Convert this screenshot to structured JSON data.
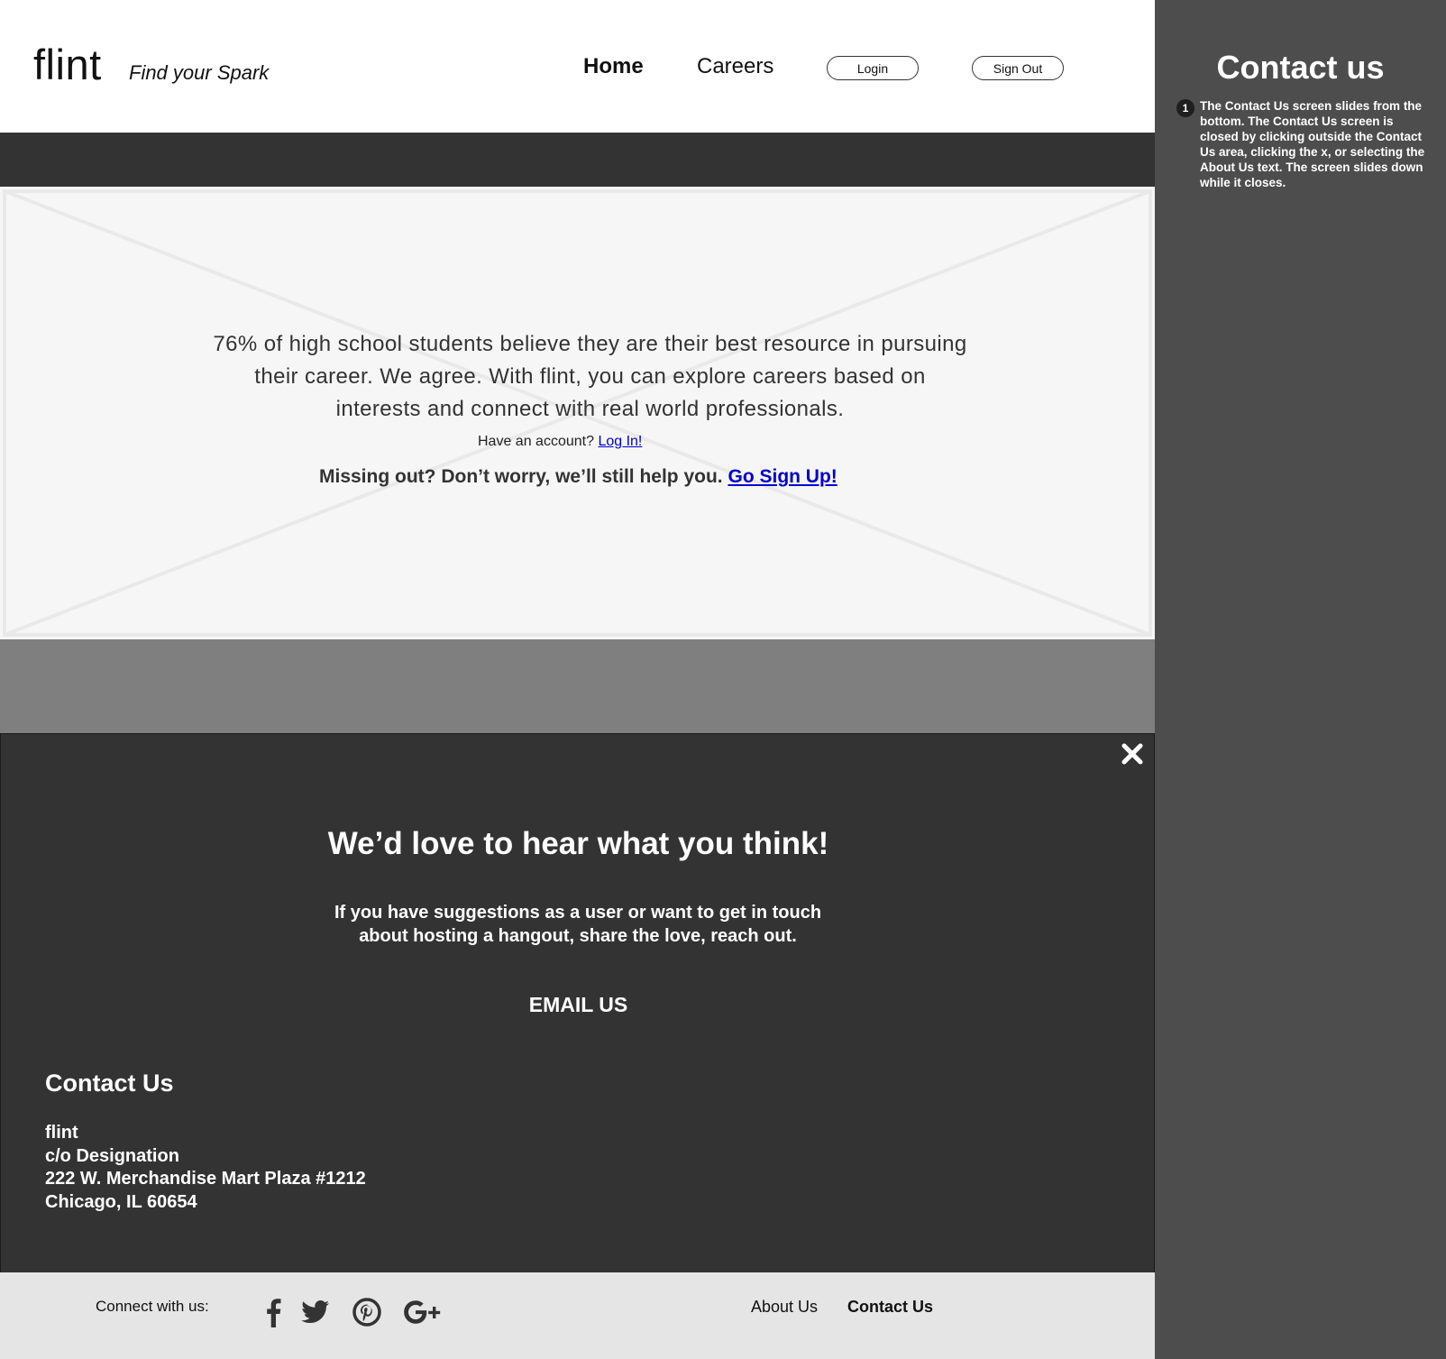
{
  "header": {
    "logo": "flint",
    "tagline": "Find your Spark",
    "nav": {
      "home": "Home",
      "careers": "Careers"
    },
    "buttons": {
      "login": "Login",
      "sign_out": "Sign Out"
    }
  },
  "hero": {
    "line1": "76% of high school students believe they are their best resource in pursuing",
    "line2": "their career. We agree. With flint, you can explore careers based on",
    "line3": "interests and connect with real world professionals.",
    "have_account": "Have an account?",
    "login_link": "Log In!",
    "missing_out": "Missing out? Don’t worry, we’ll still help you.",
    "signup_link": "Go Sign Up!"
  },
  "contact_panel": {
    "close_icon": "close-icon",
    "heading": "We’d love to hear what you think!",
    "sub_line1": "If you have suggestions as a user or want to get in touch",
    "sub_line2": "about hosting a hangout, share the love, reach out.",
    "email_us": "EMAIL US",
    "contact_title": "Contact Us",
    "address": {
      "line1": "flint",
      "line2": "c/o Designation",
      "line3": "222 W. Merchandise Mart Plaza #1212",
      "line4": "Chicago, IL 60654"
    }
  },
  "footer": {
    "connect": "Connect with us:",
    "social": [
      "facebook-icon",
      "twitter-icon",
      "pinterest-icon",
      "google-plus-icon"
    ],
    "about_us": "About Us",
    "contact_us": "Contact Us"
  },
  "sidebar": {
    "title": "Contact us",
    "note_number": "1",
    "note_text": "The Contact Us screen slides from the bottom. The Contact Us screen is closed by clicking outside the Contact Us area, clicking the x, or selecting the About Us text. The screen slides down while it closes."
  },
  "colors": {
    "dark_panel": "#333333",
    "sidebar": "#4d4d4d",
    "overlay_grey": "#7f7f7f",
    "footer_bg": "#e5e5e5",
    "link": "#0000cc"
  }
}
